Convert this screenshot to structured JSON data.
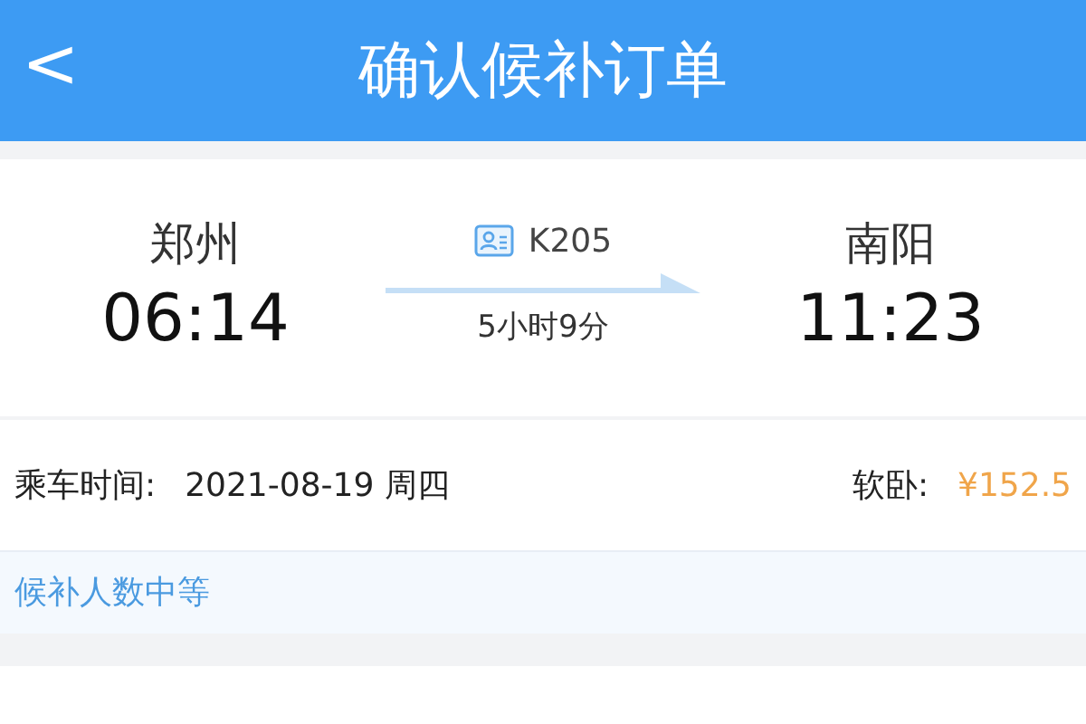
{
  "header": {
    "back_icon": "<",
    "title": "确认候补订单"
  },
  "trip": {
    "from": {
      "station": "郑州",
      "time": "06:14"
    },
    "train": "K205",
    "duration": "5小时9分",
    "to": {
      "station": "南阳",
      "time": "11:23"
    }
  },
  "info": {
    "date_label": "乘车时间:",
    "date": "2021-08-19 周四",
    "seat_label": "软卧:",
    "price": "¥152.5"
  },
  "notice": "候补人数中等"
}
